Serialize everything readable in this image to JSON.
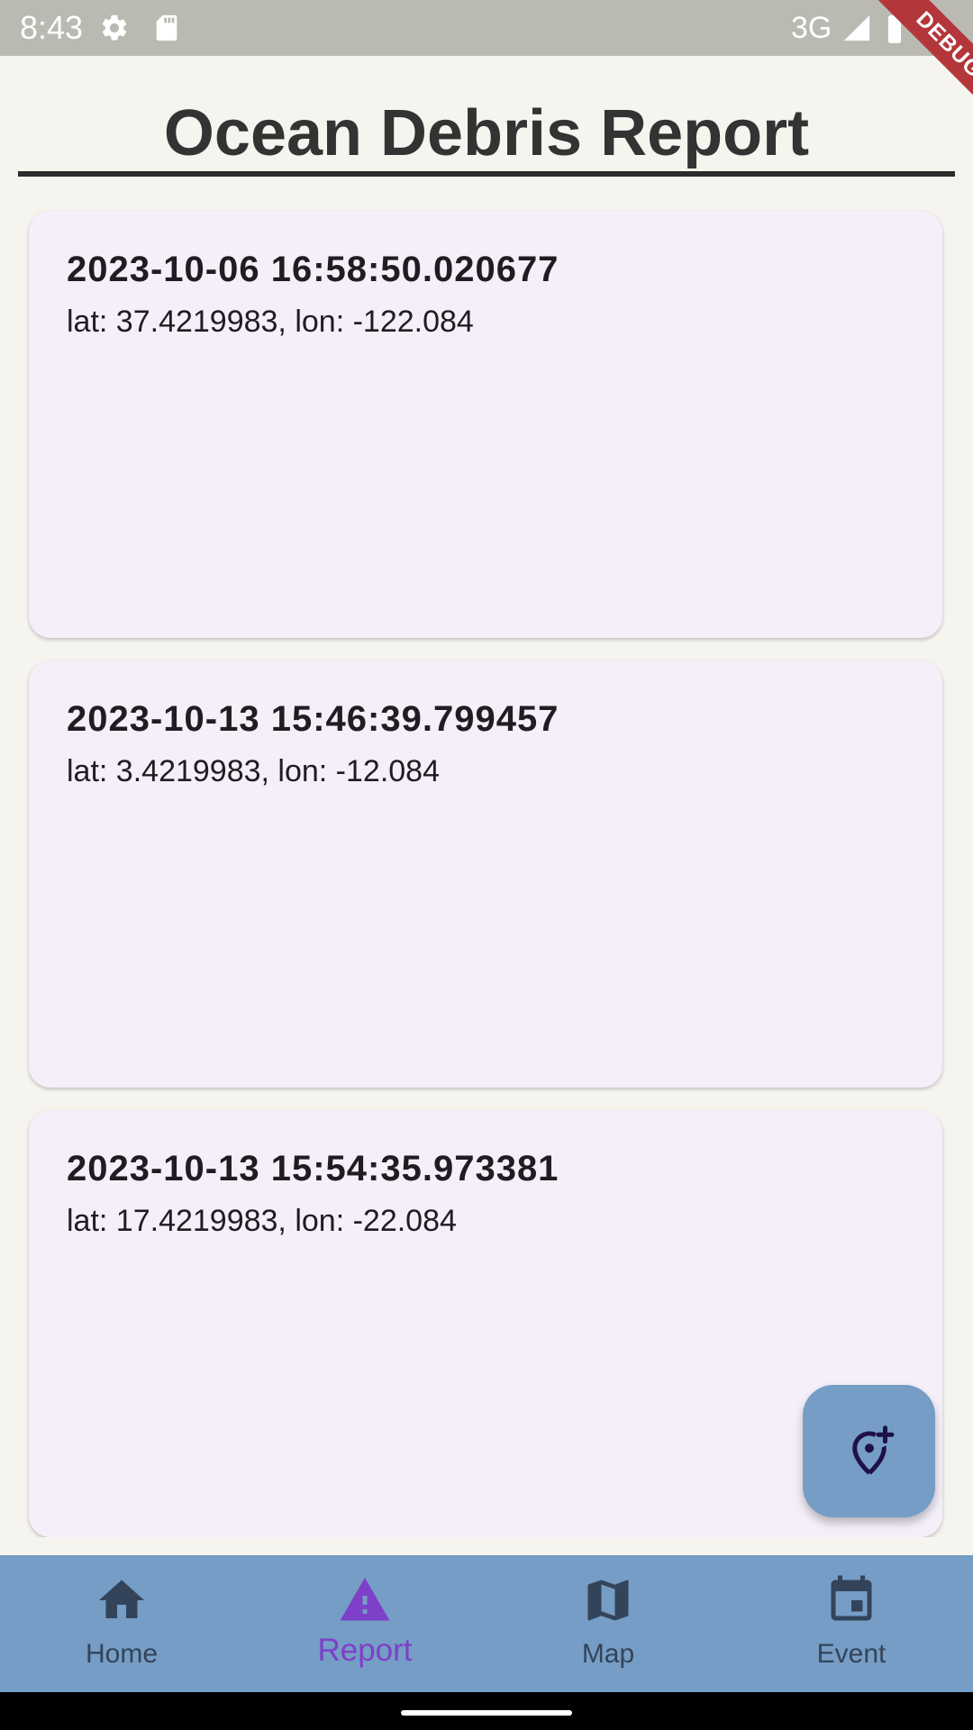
{
  "status_bar": {
    "time": "8:43",
    "network": "3G",
    "icons": [
      "gear-icon",
      "sd-card-icon",
      "signal-icon",
      "battery-icon"
    ]
  },
  "debug_banner": "DEBUG",
  "header": {
    "title": "Ocean Debris Report"
  },
  "reports": [
    {
      "timestamp": "2023-10-06 16:58:50.020677",
      "coords": "lat: 37.4219983, lon: -122.084"
    },
    {
      "timestamp": "2023-10-13 15:46:39.799457",
      "coords": "lat: 3.4219983, lon: -12.084"
    },
    {
      "timestamp": "2023-10-13 15:54:35.973381",
      "coords": "lat: 17.4219983, lon: -22.084"
    }
  ],
  "fab": {
    "icon": "add-location-icon"
  },
  "bottom_nav": {
    "items": [
      {
        "label": "Home",
        "icon": "home-icon",
        "active": false
      },
      {
        "label": "Report",
        "icon": "warning-icon",
        "active": true
      },
      {
        "label": "Map",
        "icon": "map-icon",
        "active": false
      },
      {
        "label": "Event",
        "icon": "calendar-icon",
        "active": false
      }
    ]
  },
  "colors": {
    "background": "#f6f4ee",
    "card": "#f4eff9",
    "nav_bar": "#759dc5",
    "nav_active": "#7d40c8",
    "nav_inactive": "#33445a",
    "status_bar": "#bab9b2",
    "debug_ribbon": "#b3363a"
  }
}
